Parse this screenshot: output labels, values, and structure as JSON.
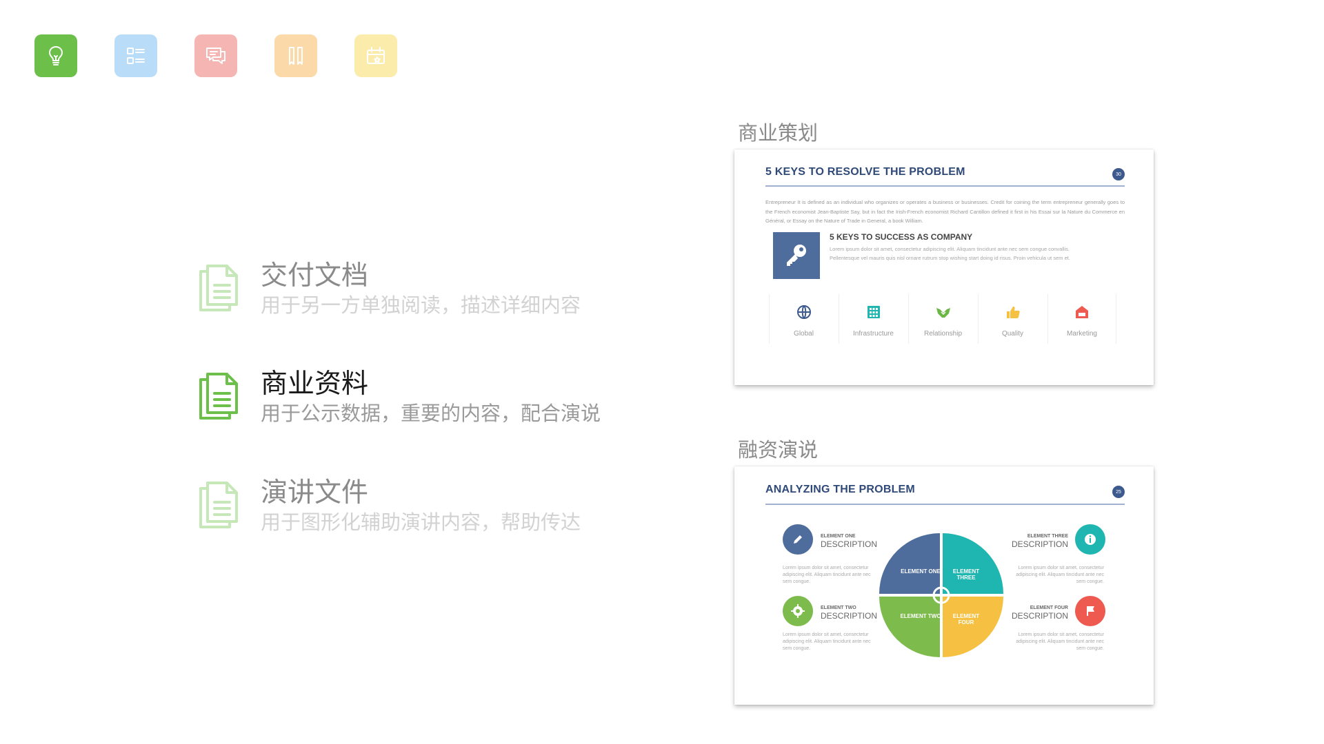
{
  "top_icons": [
    {
      "name": "lightbulb-icon",
      "bg": "#6cc04a"
    },
    {
      "name": "list-icon",
      "bg": "#b9dcf8"
    },
    {
      "name": "chat-icon",
      "bg": "#f5b5b3"
    },
    {
      "name": "bookmark-icon",
      "bg": "#fbd9a8"
    },
    {
      "name": "calendar-icon",
      "bg": "#fbecab"
    }
  ],
  "doc_list": [
    {
      "title": "交付文档",
      "subtitle": "用于另一方单独阅读，描述详细内容",
      "icon": "document-icon",
      "active": false
    },
    {
      "title": "商业资料",
      "subtitle": "用于公示数据，重要的内容，配合演说",
      "icon": "document-icon",
      "active": true
    },
    {
      "title": "演讲文件",
      "subtitle": "用于图形化辅助演讲内容，帮助传达",
      "icon": "document-icon",
      "active": false
    }
  ],
  "card1": {
    "label": "商业策划",
    "title": "5 KEYS TO RESOLVE THE PROBLEM",
    "page": "30",
    "intro": "Entrepreneur   It is defined as an individual who organizes or operates a business or businesses. Credit for coining the term entrepreneur generally goes to the French economist Jean-Baptiste Say, but in fact the Irish-French economist Richard Cantillon defined it first in his Essai sur la Nature du Commerce en Général, or Essay on the Nature of Trade in General, a book William.",
    "key_title": "5 KEYS TO SUCCESS AS COMPANY",
    "key_text": "Lorem ipsum dolor sit amet, consectetur adipiscing elit. Aliquam tincidunt ante nec sem congue convallis. Pellentesque vel mauris quis nisl ornare rutrum stop wishing start doing id risus. Proin vehicula ut sem et.",
    "features": [
      {
        "label": "Global",
        "icon": "globe-icon",
        "color": "#3d5a8e"
      },
      {
        "label": "Infrastructure",
        "icon": "building-icon",
        "color": "#1fb5b0"
      },
      {
        "label": "Relationship",
        "icon": "handshake-icon",
        "color": "#6cb648"
      },
      {
        "label": "Quality",
        "icon": "thumbs-up-icon",
        "color": "#f6c142"
      },
      {
        "label": "Marketing",
        "icon": "shop-icon",
        "color": "#ee5a4f"
      }
    ]
  },
  "card2": {
    "label": "融资演说",
    "title": "ANALYZING THE PROBLEM",
    "page": "25",
    "elements": [
      {
        "small": "ELEMENT ONE",
        "big": "DESCRIPTION",
        "icon": "pencil-icon",
        "color": "#4e6c9c",
        "text": "Lorem ipsum dolor sit amet, consectetur adipiscing elit. Aliquam tincidunt ante nec sem congue.",
        "pie": "ELEMENT ONE"
      },
      {
        "small": "ELEMENT TWO",
        "big": "DESCRIPTION",
        "icon": "gear-icon",
        "color": "#7dbb4c",
        "text": "Lorem ipsum dolor sit amet, consectetur adipiscing elit. Aliquam tincidunt ante nec sem congue.",
        "pie": "ELEMENT TWO"
      },
      {
        "small": "ELEMENT THREE",
        "big": "DESCRIPTION",
        "icon": "info-icon",
        "color": "#1fb5b0",
        "text": "Lorem ipsum dolor sit amet, consectetur adipiscing elit. Aliquam tincidunt ante nec sem congue.",
        "pie": "ELEMENT THREE"
      },
      {
        "small": "ELEMENT FOUR",
        "big": "DESCRIPTION",
        "icon": "flag-icon",
        "color": "#ee5a4f",
        "text": "Lorem ipsum dolor sit amet, consectetur adipiscing elit. Aliquam tincidunt ante nec sem congue.",
        "pie": "ELEMENT FOUR"
      }
    ],
    "pie_colors": {
      "one": "#4e6c9c",
      "two": "#7dbb4c",
      "three": "#1fb5b0",
      "four": "#f6c142"
    }
  }
}
